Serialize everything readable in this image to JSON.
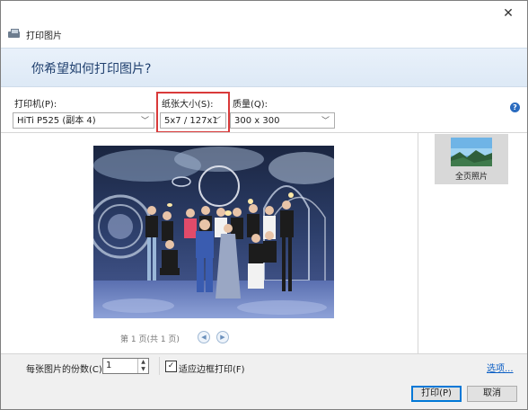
{
  "window": {
    "title": "打印图片",
    "close_glyph": "✕"
  },
  "banner": {
    "question": "你希望如何打印图片?"
  },
  "printer": {
    "label": "打印机(P):",
    "value": "HiTi P525 (副本 4)"
  },
  "paper_size": {
    "label": "纸张大小(S):",
    "value": "5x7 / 127x1"
  },
  "quality": {
    "label": "质量(Q):",
    "value": "300 x 300"
  },
  "help": {
    "glyph": "?"
  },
  "preview": {
    "page_status": "第 1 页(共 1 页)"
  },
  "layouts": [
    {
      "label": "全页照片",
      "selected": true
    }
  ],
  "copies": {
    "label": "每张图片的份数(C):",
    "value": "1"
  },
  "fit_frame": {
    "label": "适应边框打印(F)",
    "checked": true
  },
  "options_link": {
    "label": "选项..."
  },
  "buttons": {
    "print": "打印(P)",
    "cancel": "取消"
  },
  "icons": {
    "close": "close-icon",
    "app": "printer-photo-icon",
    "help": "help-icon",
    "prev": "prev-page-icon",
    "next": "next-page-icon",
    "checkbox": "checkmark-icon"
  },
  "colors": {
    "banner_text": "#1f3f6e",
    "highlight_box": "#d93a3a",
    "link": "#0b5ec4",
    "accent": "#0078d7"
  }
}
